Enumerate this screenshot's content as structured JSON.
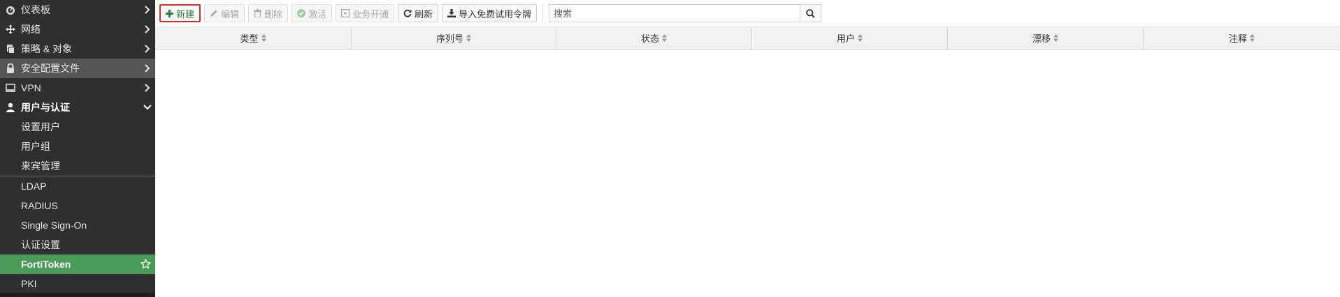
{
  "sidebar": {
    "items": [
      {
        "label": "仪表板",
        "icon": "dashboard-icon"
      },
      {
        "label": "网络",
        "icon": "network-icon"
      },
      {
        "label": "策略 & 对象",
        "icon": "policy-icon"
      },
      {
        "label": "安全配置文件",
        "icon": "lock-icon"
      },
      {
        "label": "VPN",
        "icon": "monitor-icon"
      },
      {
        "label": "用户与认证",
        "icon": "user-icon"
      }
    ],
    "sub_items": [
      "设置用户",
      "用户组",
      "来宾管理",
      "LDAP",
      "RADIUS",
      "Single Sign-On",
      "认证设置",
      "FortiToken",
      "PKI"
    ],
    "selected": "FortiToken",
    "colors": {
      "background": "#2f2f2f",
      "selected": "#4a9a58",
      "active_profile": "#555555"
    }
  },
  "toolbar": {
    "new_label": "新建",
    "edit_label": "编辑",
    "delete_label": "删除",
    "activate_label": "激活",
    "provision_label": "业务开通",
    "refresh_label": "刷新",
    "import_label": "导入免费试用令牌"
  },
  "search": {
    "placeholder": "搜索",
    "value": ""
  },
  "table": {
    "columns": [
      "类型",
      "序列号",
      "状态",
      "用户",
      "漂移",
      "注释"
    ]
  }
}
